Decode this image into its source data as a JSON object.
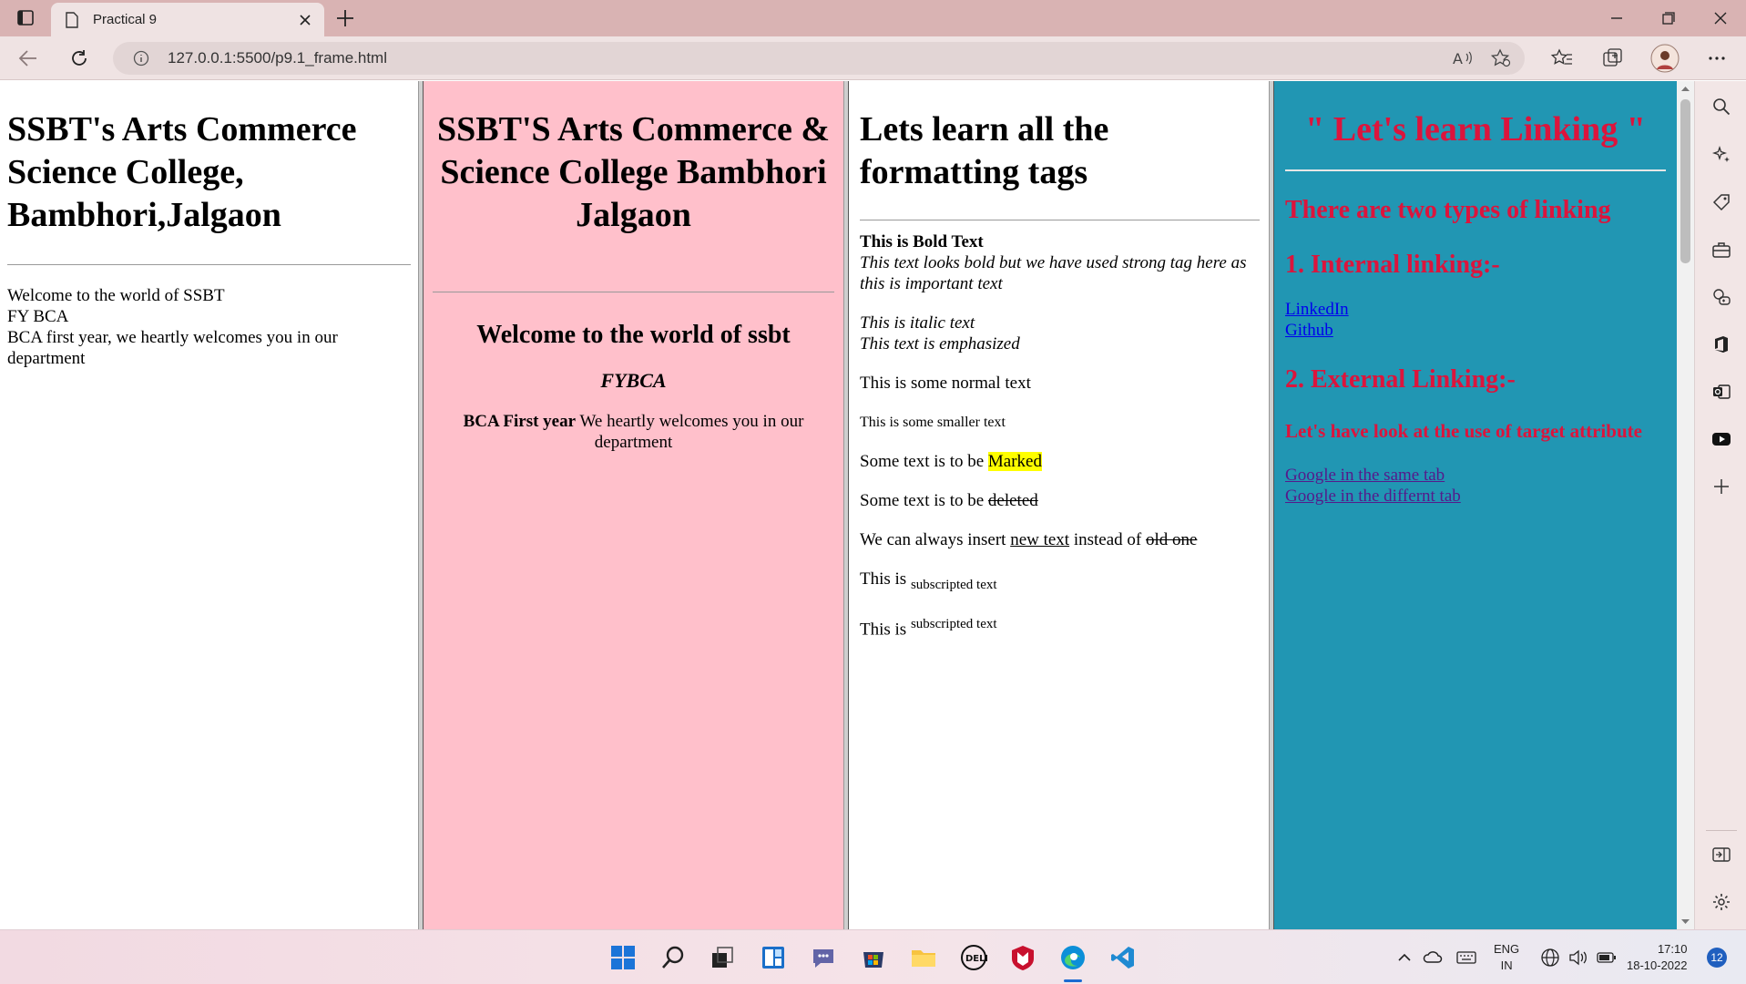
{
  "browser": {
    "tab_title": "Practical 9",
    "url": "127.0.0.1:5500/p9.1_frame.html"
  },
  "frame1": {
    "heading": "SSBT's Arts Commerce Science College, Bambhori,Jalgaon",
    "line1": "Welcome to the world of SSBT",
    "line2": "FY BCA",
    "line3": "BCA first year, we heartly welcomes you in our department"
  },
  "frame2": {
    "heading": "SSBT'S Arts Commerce & Science College Bambhori Jalgaon",
    "subheading": "Welcome to the world of ssbt",
    "course": "FYBCA",
    "bold_text": "BCA First year",
    "text": " We heartly welcomes you in our department"
  },
  "frame3": {
    "heading": "Lets learn all the formatting tags",
    "bold": "This is Bold Text",
    "strong": "This text looks bold but we have used strong tag here as this is important text",
    "italic": "This is italic text",
    "emphasized": "This text is emphasized",
    "normal": "This is some normal text",
    "smaller": "This is some smaller text",
    "marked_prefix": "Some text is to be ",
    "marked": "Marked",
    "deleted_prefix": "Some text is to be ",
    "deleted": "deleted",
    "insert_prefix": "We can always insert ",
    "inserted": "new text",
    "insert_middle": " instead of ",
    "old": "old one",
    "sub_prefix": "This is ",
    "sub_text": "subscripted text",
    "sup_prefix": "This is ",
    "sup_text": "subscripted text"
  },
  "frame4": {
    "heading": "\" Let's learn Linking \"",
    "types": "There are two types of linking",
    "internal": "1. Internal linking:-",
    "link1": "LinkedIn",
    "link2": "Github",
    "external": "2. External Linking:-",
    "target_heading": "Let's have look at the use of target attribute",
    "link3": "Google in the same tab",
    "link4": "Google in the differnt tab"
  },
  "tray": {
    "lang1": "ENG",
    "lang2": "IN",
    "time": "17:10",
    "date": "18-10-2022",
    "notifications": "12"
  },
  "colors": {
    "tabbar": "#d9b3b3",
    "frame2_bg": "#ffc0cb",
    "frame4_bg": "#2196b3",
    "frame4_text": "#dc143c"
  }
}
